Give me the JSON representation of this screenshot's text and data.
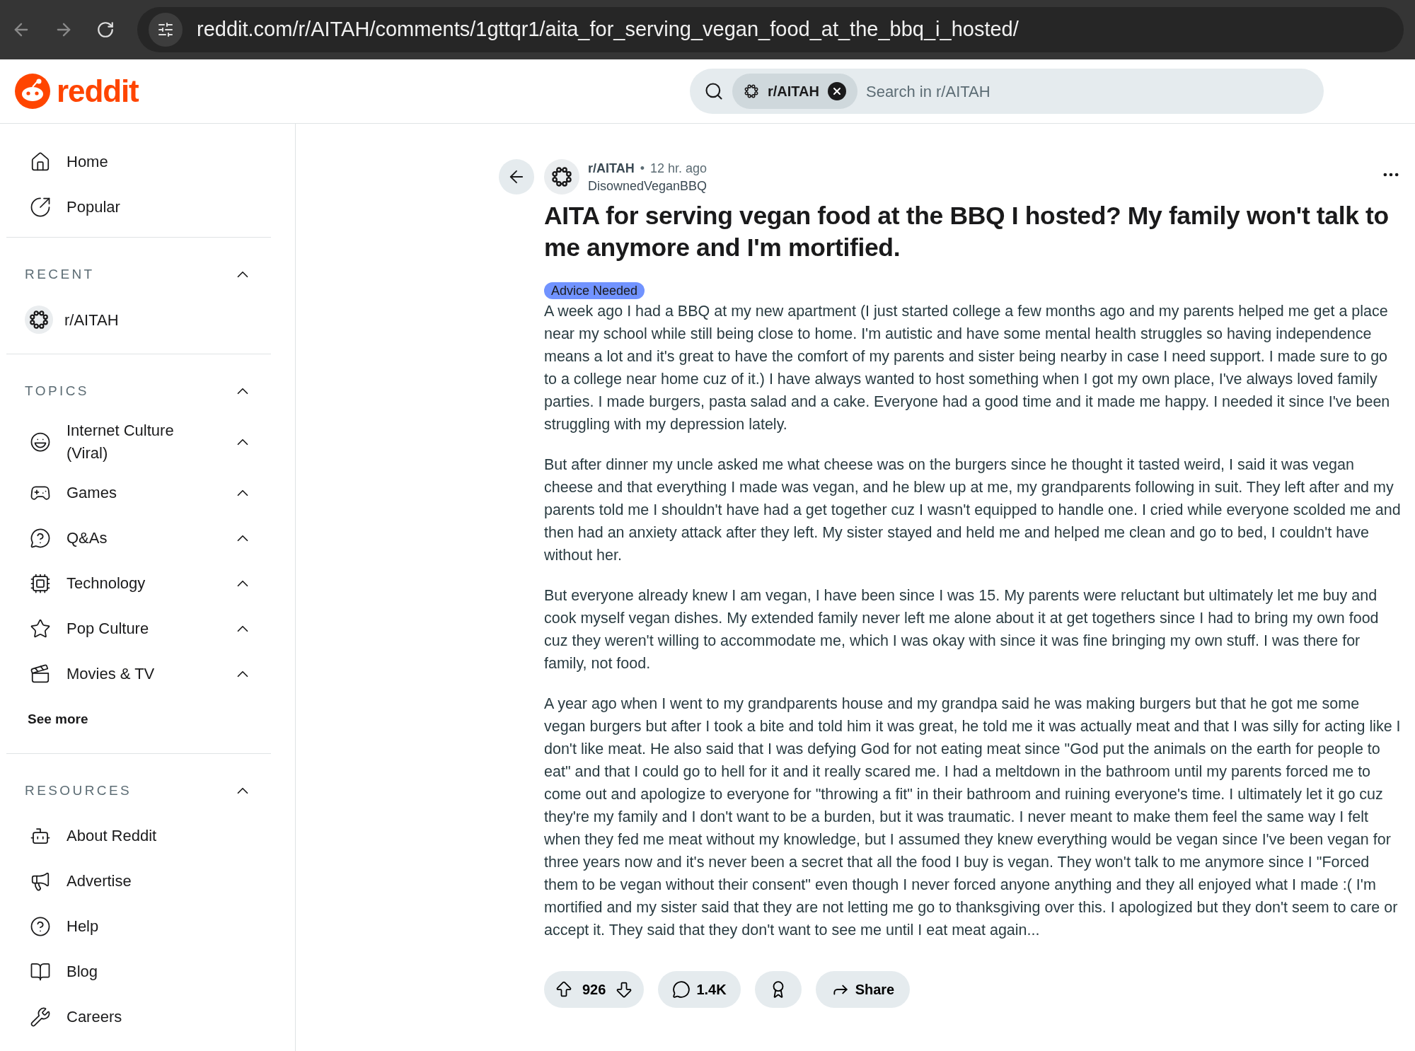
{
  "browser": {
    "url": "reddit.com/r/AITAH/comments/1gttqr1/aita_for_serving_vegan_food_at_the_bbq_i_hosted/"
  },
  "header": {
    "logo_text": "reddit",
    "search": {
      "chip": "r/AITAH",
      "placeholder": "Search in r/AITAH"
    }
  },
  "sidebar": {
    "nav": [
      {
        "label": "Home",
        "selected": false
      },
      {
        "label": "Popular",
        "selected": false
      }
    ],
    "sections": [
      {
        "title": "RECENT",
        "expanded": true,
        "items": [
          {
            "label": "r/AITAH"
          }
        ]
      },
      {
        "title": "TOPICS",
        "expanded": true,
        "items": [
          {
            "label": "Internet Culture (Viral)",
            "expanded": true
          },
          {
            "label": "Games",
            "expanded": true
          },
          {
            "label": "Q&As",
            "expanded": true
          },
          {
            "label": "Technology",
            "expanded": true
          },
          {
            "label": "Pop Culture",
            "expanded": true
          },
          {
            "label": "Movies & TV",
            "expanded": true
          }
        ],
        "see_more": "See more"
      },
      {
        "title": "RESOURCES",
        "expanded": true,
        "items": [
          {
            "label": "About Reddit"
          },
          {
            "label": "Advertise"
          },
          {
            "label": "Help"
          },
          {
            "label": "Blog"
          },
          {
            "label": "Careers"
          }
        ]
      }
    ]
  },
  "post": {
    "subreddit": "r/AITAH",
    "separator": "•",
    "time": "12 hr. ago",
    "author": "DisownedVeganBBQ",
    "title": "AITA for serving vegan food at the BBQ I hosted? My family won't talk to me anymore and I'm mortified.",
    "flair": {
      "label": "Advice Needed",
      "color": "#7193ff"
    },
    "paragraphs": [
      "A week ago I had a BBQ at my new apartment (I just started college a few months ago and my parents helped me get a place near my school while still being close to home. I'm autistic and have some mental health struggles so having independence means a lot and it's great to have the comfort of my parents and sister being nearby in case I need support. I made sure to go to a college near home cuz of it.) I have always wanted to host something when I got my own place, I've always loved family parties. I made burgers, pasta salad and a cake. Everyone had a good time and it made me happy. I needed it since I've been struggling with my depression lately.",
      "But after dinner my uncle asked me what cheese was on the burgers since he thought it tasted weird, I said it was vegan cheese and that everything I made was vegan, and he blew up at me, my grandparents following in suit. They left after and my parents told me I shouldn't have had a get together cuz I wasn't equipped to handle one. I cried while everyone scolded me and then had an anxiety attack after they left. My sister stayed and held me and helped me clean and go to bed, I couldn't have without her.",
      "But everyone already knew I am vegan, I have been since I was 15. My parents were reluctant but ultimately let me buy and cook myself vegan dishes. My extended family never left me alone about it at get togethers since I had to bring my own food cuz they weren't willing to accommodate me, which I was okay with since it was fine bringing my own stuff. I was there for family, not food.",
      "A year ago when I went to my grandparents house and my grandpa said he was making burgers but that he got me some vegan burgers but after I took a bite and told him it was great, he told me it was actually meat and that I was silly for acting like I don't like meat. He also said that I was defying God for not eating meat since \"God put the animals on the earth for people to eat\" and that I could go to hell for it and it really scared me. I had a meltdown in the bathroom until my parents forced me to come out and apologize to everyone for \"throwing a fit\" in their bathroom and ruining everyone's time. I ultimately let it go cuz they're my family and I don't want to be a burden, but it was traumatic. I never meant to make them feel the same way I felt when they fed me meat without my knowledge, but I assumed they knew everything would be vegan since I've been vegan for three years now and it's never been a secret that all the food I buy is vegan. They won't talk to me anymore since I \"Forced them to be vegan without their consent\" even though I never forced anyone anything and they all enjoyed what I made :( I'm mortified and my sister said that they are not letting me go to thanksgiving over this. I apologized but they don't seem to care or accept it. They said that they don't want to see me until I eat meat again..."
    ],
    "actions": {
      "score": "926",
      "comments": "1.4K",
      "share": "Share"
    }
  }
}
